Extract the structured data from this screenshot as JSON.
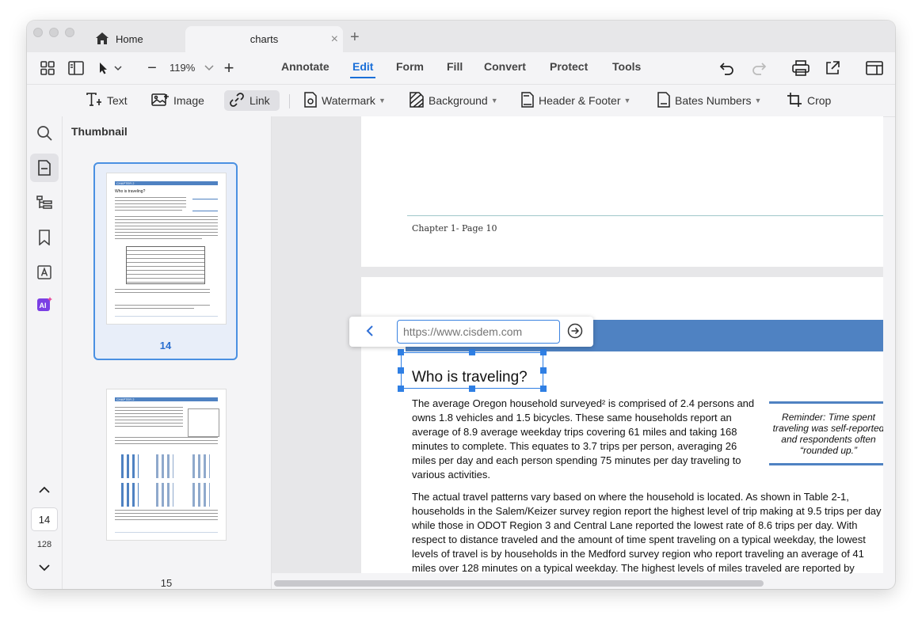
{
  "tabs": {
    "home_label": "Home",
    "active_label": "charts",
    "close_glyph": "×",
    "new_glyph": "+"
  },
  "toolbar": {
    "zoom_minus": "−",
    "zoom_value": "119%",
    "zoom_plus": "+",
    "menus": [
      "Annotate",
      "Edit",
      "Form",
      "Fill",
      "Convert",
      "Protect",
      "Tools"
    ],
    "active_menu": "Edit",
    "accent_color": "#1a6fd8"
  },
  "edit_tools": {
    "text": "Text",
    "image": "Image",
    "link": "Link",
    "watermark": "Watermark",
    "background": "Background",
    "header_footer": "Header & Footer",
    "bates_numbers": "Bates Numbers",
    "crop": "Crop"
  },
  "sidebar": {
    "title": "Thumbnail",
    "current_page": "14",
    "total_pages": "128",
    "thumbnails": [
      {
        "page": "14",
        "header": "CHAPTER 2",
        "heading": "Who is traveling?"
      },
      {
        "page": "15",
        "header": "CHAPTER 2"
      }
    ]
  },
  "document": {
    "prev_page_footer": "Chapter 1- Page 10",
    "heading": "Who is traveling?",
    "para1": [
      "The average Oregon household surveyed² is comprised of 2.4 persons and",
      "owns 1.8 vehicles and 1.5 bicycles. These same households report an",
      "average of 8.9 average weekday trips covering 61 miles and taking 168",
      "minutes to complete. This equates to 3.7 trips per person, averaging 26",
      "miles per day and each person spending 75 minutes per day traveling to",
      "various activities."
    ],
    "callout": [
      "Reminder:  Time spent",
      "traveling was self-reported",
      "and respondents often",
      "“rounded up.”"
    ],
    "para2": [
      "The actual travel patterns vary based on where the household is located. As shown in Table 2-1,",
      "households in the Salem/Keizer survey region report the highest level of trip making at 9.5 trips per day",
      "while those in ODOT Region 3 and Central Lane reported the lowest rate of 8.6 trips per day. With",
      "respect to distance traveled and the amount of time spent traveling on a typical weekday, the lowest",
      "levels of travel is by households in the Medford survey region who report traveling an average of 41",
      "miles over 128 minutes on a typical weekday. The highest levels of miles traveled are reported by"
    ],
    "banner_color": "#4f82c2"
  },
  "link_popup": {
    "placeholder": "https://www.cisdem.com"
  }
}
